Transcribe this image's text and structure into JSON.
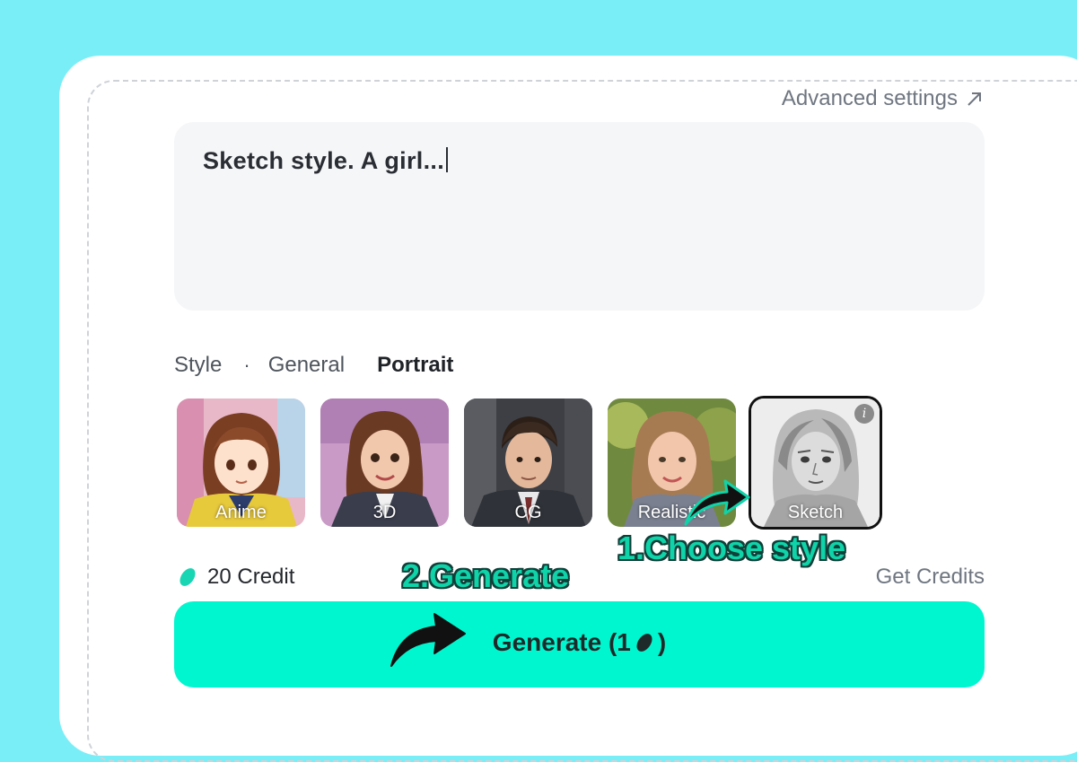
{
  "panel": {
    "advanced_settings": "Advanced settings",
    "arrow_icon": "arrow-up-right-icon"
  },
  "prompt": {
    "value": "Sketch style. A girl..."
  },
  "style": {
    "label": "Style",
    "separator": "·",
    "tabs": [
      {
        "label": "General",
        "active": false
      },
      {
        "label": "Portrait",
        "active": true
      }
    ],
    "thumbnails": [
      {
        "label": "Anime",
        "selected": false
      },
      {
        "label": "3D",
        "selected": false
      },
      {
        "label": "CG",
        "selected": false
      },
      {
        "label": "Realistic",
        "selected": false
      },
      {
        "label": "Sketch",
        "selected": true,
        "info_icon": "info-icon"
      }
    ]
  },
  "annotations": {
    "choose_style": "1.Choose  style",
    "generate": "2.Generate"
  },
  "credits": {
    "amount_label": "20 Credit",
    "get_credits": "Get Credits",
    "icon": "bean-icon"
  },
  "generate_button": {
    "label": "Generate (1",
    "close_paren": ")"
  },
  "colors": {
    "background": "#7aeef7",
    "accent": "#00f6cf",
    "annotation": "#0fd3a9",
    "credit_icon": "#18d6b3"
  }
}
